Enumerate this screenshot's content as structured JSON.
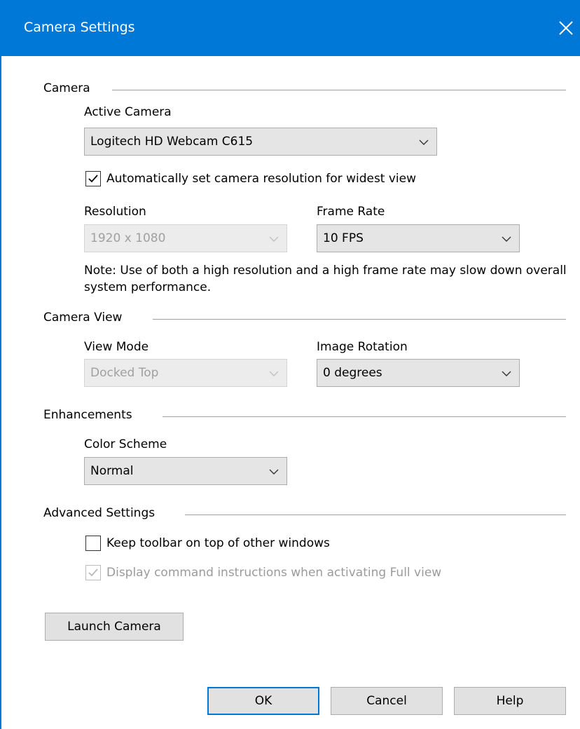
{
  "window": {
    "title": "Camera Settings"
  },
  "camera": {
    "section_label": "Camera",
    "active_camera_label": "Active Camera",
    "active_camera_value": "Logitech HD Webcam C615",
    "auto_resolution": {
      "label": "Automatically set camera resolution for widest view",
      "checked": true
    },
    "resolution_label": "Resolution",
    "resolution_value": "1920 x 1080",
    "frame_rate_label": "Frame Rate",
    "frame_rate_value": "10 FPS",
    "note": "Note: Use of both a high resolution and a high frame rate may slow down overall system performance."
  },
  "camera_view": {
    "section_label": "Camera View",
    "view_mode_label": "View Mode",
    "view_mode_value": "Docked Top",
    "image_rotation_label": "Image Rotation",
    "image_rotation_value": "0 degrees"
  },
  "enhancements": {
    "section_label": "Enhancements",
    "color_scheme_label": "Color Scheme",
    "color_scheme_value": "Normal"
  },
  "advanced": {
    "section_label": "Advanced Settings",
    "keep_on_top": {
      "label": "Keep toolbar on top of other windows",
      "checked": false
    },
    "display_instructions": {
      "label": "Display command instructions when activating Full view",
      "checked": true,
      "disabled": true
    }
  },
  "buttons": {
    "launch": "Launch Camera",
    "ok": "OK",
    "cancel": "Cancel",
    "help": "Help"
  },
  "colors": {
    "accent": "#0078d7"
  }
}
